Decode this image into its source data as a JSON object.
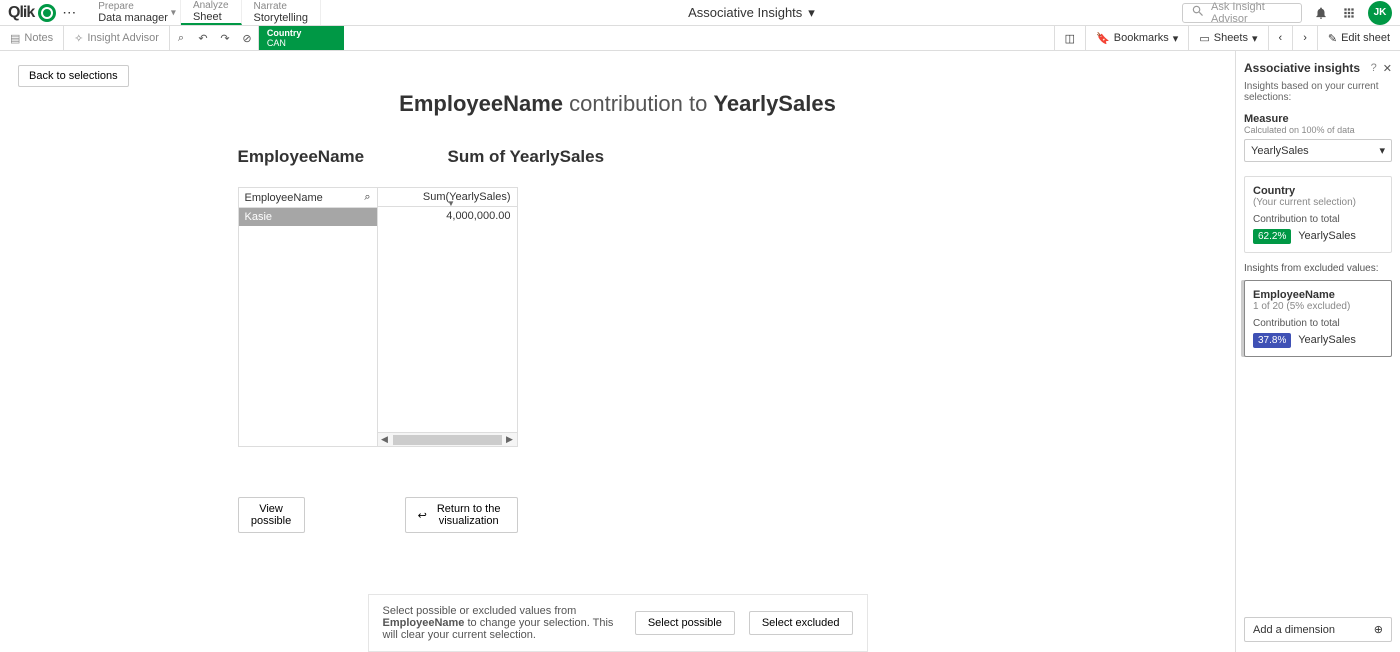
{
  "topbar": {
    "logo_text": "Qlik",
    "nav": [
      {
        "top": "Prepare",
        "sub": "Data manager",
        "active": false,
        "hasChev": true
      },
      {
        "top": "Analyze",
        "sub": "Sheet",
        "active": true,
        "hasChev": false
      },
      {
        "top": "Narrate",
        "sub": "Storytelling",
        "active": false,
        "hasChev": false
      }
    ],
    "title": "Associative Insights",
    "search_placeholder": "Ask Insight Advisor",
    "avatar": "JK"
  },
  "toolbar": {
    "notes": "Notes",
    "insight_advisor": "Insight Advisor",
    "selection": {
      "label": "Country",
      "value": "CAN"
    },
    "bookmarks": "Bookmarks",
    "sheets": "Sheets",
    "edit_sheet": "Edit sheet"
  },
  "main": {
    "back": "Back to selections",
    "headline_strong1": "EmployeeName",
    "headline_mid": " contribution to ",
    "headline_strong2": "YearlySales",
    "col1": "EmployeeName",
    "col2": "Sum of YearlySales",
    "th_left": "EmployeeName",
    "th_right": "Sum(YearlySales)",
    "row_name": "Kasie",
    "row_val": "4,000,000.00",
    "view_possible": "View possible",
    "return_viz": "Return to the visualization",
    "footer_pre": "Select possible or excluded values from ",
    "footer_bold": "EmployeeName",
    "footer_post": " to change your selection. This will clear your current selection.",
    "select_possible": "Select possible",
    "select_excluded": "Select excluded"
  },
  "side": {
    "title": "Associative insights",
    "subtitle": "Insights based on your current selections:",
    "measure_label": "Measure",
    "measure_desc": "Calculated on 100% of data",
    "measure_value": "YearlySales",
    "card1_title": "Country",
    "card1_sub": "(Your current selection)",
    "card1_row": "Contribution to total",
    "card1_badge": "62.2%",
    "card1_after": "YearlySales",
    "section2": "Insights from excluded values:",
    "card2_title": "EmployeeName",
    "card2_sub": "1 of 20 (5% excluded)",
    "card2_row": "Contribution to total",
    "card2_badge": "37.8%",
    "card2_after": "YearlySales",
    "add_dimension": "Add a dimension"
  }
}
